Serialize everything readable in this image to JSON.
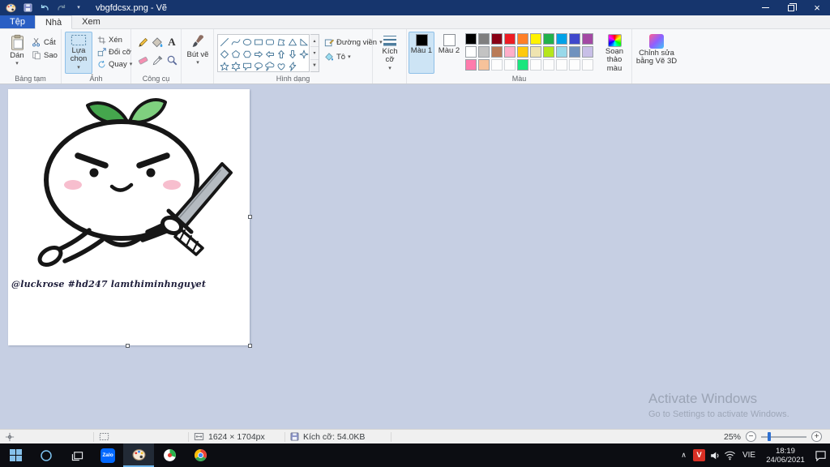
{
  "window": {
    "title": "vbgfdcsx.png - Vẽ"
  },
  "tabs": {
    "file": "Tệp",
    "home": "Nhà",
    "view": "Xem"
  },
  "ribbon": {
    "clipboard": {
      "label": "Bảng tạm",
      "paste": "Dán",
      "cut": "Cắt",
      "copy": "Sao"
    },
    "image": {
      "label": "Ảnh",
      "select": "Lựa chọn",
      "crop": "Xén",
      "resize": "Đổi cỡ",
      "rotate": "Quay"
    },
    "tools": {
      "label": "Công cụ",
      "brushes": "Bút vẽ"
    },
    "shapes": {
      "label": "Hình dạng",
      "outline": "Đường viền",
      "fill": "Tô",
      "items": [
        "line",
        "curve",
        "oval",
        "rectangle",
        "rounded-rectangle",
        "polygon",
        "triangle",
        "right-triangle",
        "diamond",
        "pentagon",
        "hexagon",
        "arrow-right",
        "arrow-left",
        "arrow-up",
        "arrow-down",
        "star-4",
        "star-5",
        "star-6",
        "callout-rectangle",
        "callout-oval",
        "callout-cloud",
        "heart",
        "lightning"
      ]
    },
    "size": {
      "label": "Kích cỡ"
    },
    "colors": {
      "label": "Màu",
      "color1": "Màu 1",
      "color2": "Màu 2",
      "edit": "Soạn thảo màu",
      "color1_value": "#000000",
      "color2_value": "#ffffff",
      "palette_row1": [
        "#000000",
        "#7f7f7f",
        "#880015",
        "#ed1c24",
        "#ff7f27",
        "#fff200",
        "#22b14c",
        "#00a2e8",
        "#3f48cc",
        "#a349a4"
      ],
      "palette_row2": [
        "#ffffff",
        "#c3c3c3",
        "#b97a57",
        "#ffaec9",
        "#ffc90e",
        "#efe4b0",
        "#b5e61d",
        "#99d9ea",
        "#7092be",
        "#c8bfe7"
      ],
      "palette_row3": [
        "#ff7bac",
        "#f7c29a",
        "",
        "",
        "#19e67d",
        "",
        "",
        "",
        "",
        ""
      ]
    },
    "paint3d": {
      "label": "Chỉnh sửa bằng Vẽ 3D"
    }
  },
  "canvas": {
    "signature": "@luckrose #hd247 lamthiminhnguyet"
  },
  "watermark": {
    "line1": "Activate Windows",
    "line2": "Go to Settings to activate Windows."
  },
  "statusbar": {
    "dimensions": "1624 × 1704px",
    "filesize": "Kích cỡ: 54.0KB",
    "zoom": "25%",
    "zoom_out": "−",
    "zoom_in": "+"
  },
  "taskbar": {
    "language": "VIE",
    "time": "18:19",
    "date": "24/06/2021"
  },
  "icons": {
    "caret": "▾",
    "up_small": "▴",
    "down_small": "▾",
    "more": "▼",
    "text_tool": "A",
    "close": "×",
    "ime_letter": "V",
    "zalo": "Zalo",
    "chevron_up": "∧"
  }
}
